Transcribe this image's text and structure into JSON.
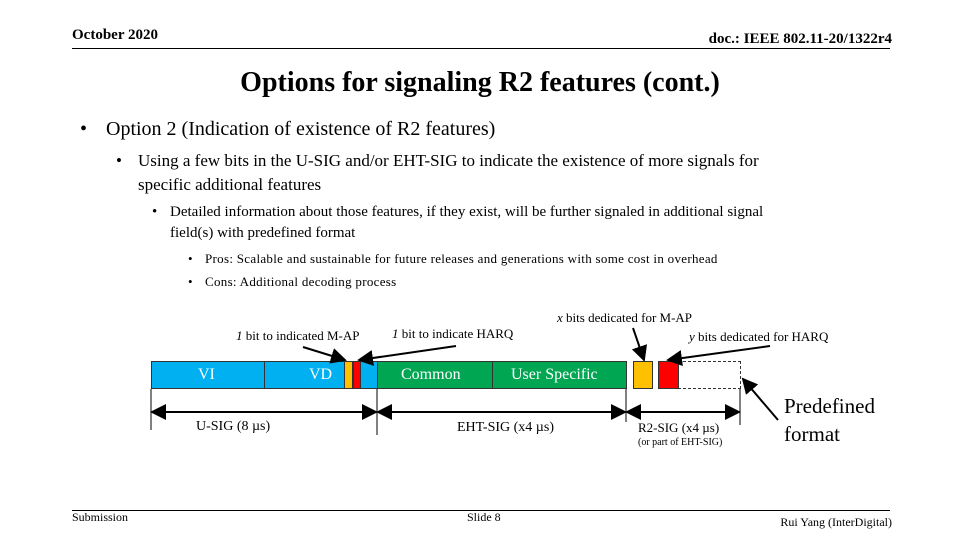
{
  "header": {
    "date": "October 2020",
    "doc": "doc.: IEEE 802.11-20/1322r4"
  },
  "title": "Options for signaling R2 features (cont.)",
  "bullets": {
    "l1": "Option 2 (Indication of existence of R2 features)",
    "l2_line1": "Using a few bits in the U-SIG and/or EHT-SIG to indicate the existence of more signals for",
    "l2_line2": "specific additional features",
    "l3_line1": "Detailed information about those features, if they exist, will be further signaled in additional signal",
    "l3_line2": "field(s) with predefined format",
    "pros": "Pros: Scalable and sustainable for future releases and generations with some cost in overhead",
    "cons": "Cons: Additional decoding process"
  },
  "diagram": {
    "map_bit_label": {
      "var": "1",
      "text": " bit to indicated M-AP"
    },
    "harq_bit_label": {
      "var": "1",
      "text": " bit to indicate HARQ"
    },
    "x_bits_label": {
      "var": "x",
      "text": " bits dedicated for M-AP"
    },
    "y_bits_label": {
      "var": "y",
      "text": " bits dedicated for HARQ"
    },
    "segments": {
      "vi": "VI",
      "vd": "VD",
      "common": "Common",
      "user_specific": "User Specific"
    },
    "usig": "U-SIG (8 µs)",
    "ehtsig": "EHT-SIG (x4 µs)",
    "r2sig": "R2-SIG (x4 µs)",
    "r2sig_note": "(or part of EHT-SIG)",
    "predefined_line1": "Predefined",
    "predefined_line2": "format",
    "colors": {
      "usig": "#00b0f0",
      "ehtsig": "#00a651",
      "map": "#ffc000",
      "harq": "#ff0000"
    }
  },
  "footer": {
    "left": "Submission",
    "center": "Slide 8",
    "right": "Rui Yang (InterDigital)"
  }
}
